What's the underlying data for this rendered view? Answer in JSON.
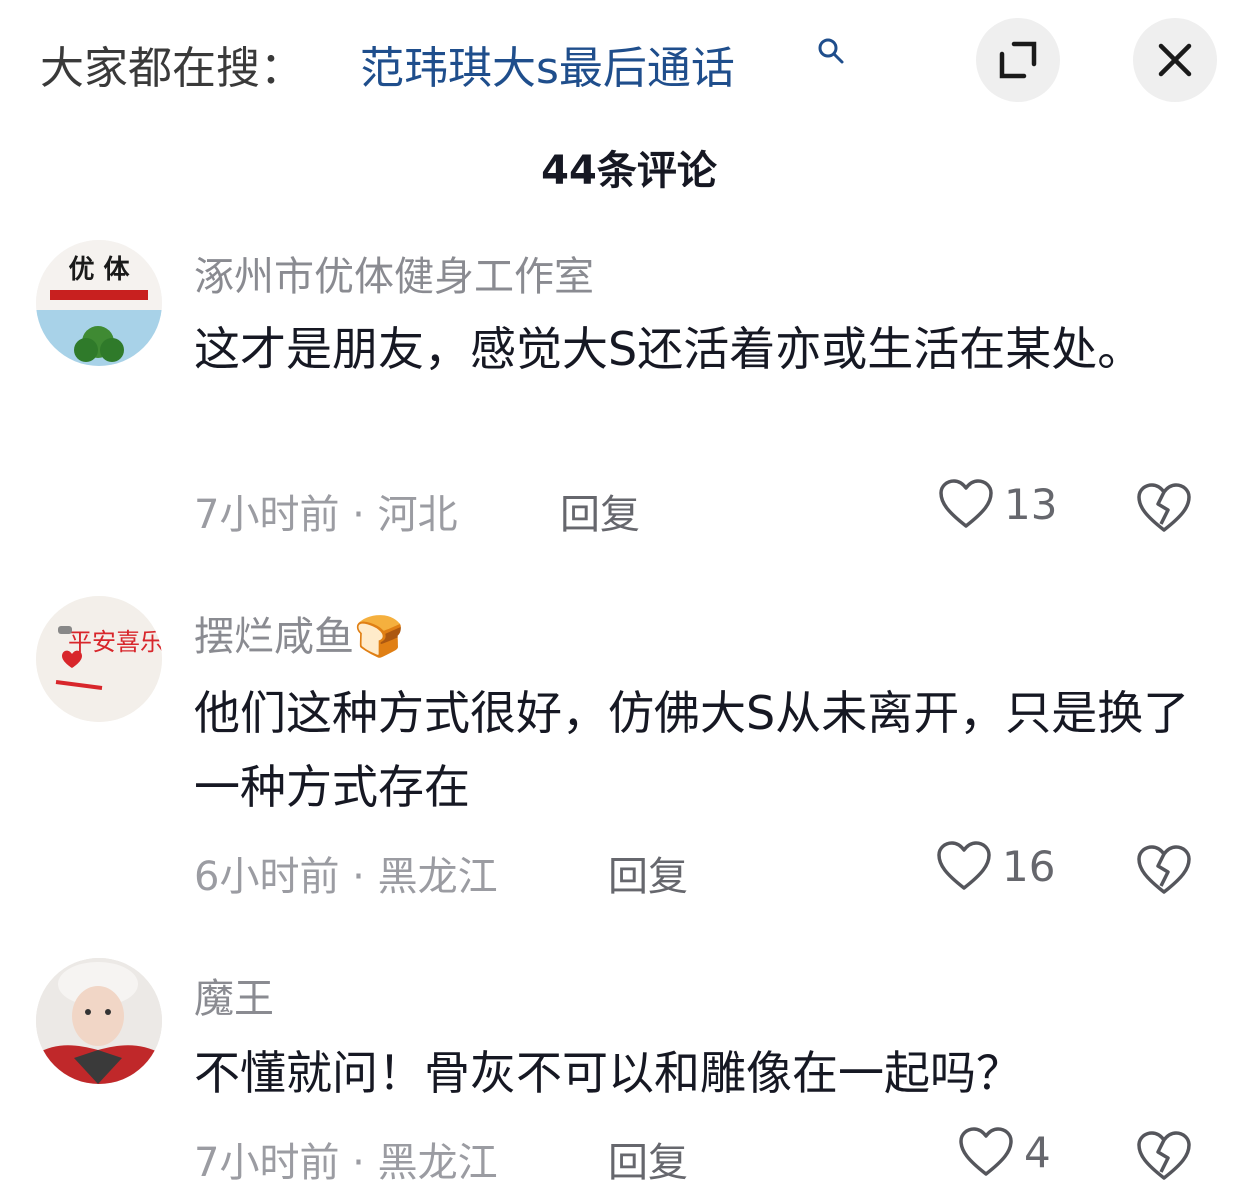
{
  "header": {
    "search_prefix": "大家都在搜：",
    "search_term": "范玮琪大s最后通话",
    "comment_count": "44条评论"
  },
  "comments": [
    {
      "username": "涿州市优体健身工作室",
      "avatar_text": "优 体",
      "text": "这才是朋友，感觉大S还活着亦或生活在某处。",
      "time": "7小时前",
      "location": "河北",
      "reply": "回复",
      "likes": "13"
    },
    {
      "username": "摆烂咸鱼🍞",
      "avatar_text": "平安喜乐",
      "text": "他们这种方式很好，仿佛大S从未离开，只是换了一种方式存在",
      "time": "6小时前",
      "location": "黑龙江",
      "reply": "回复",
      "likes": "16"
    },
    {
      "username": "魔王",
      "text": "不懂就问！骨灰不可以和雕像在一起吗？",
      "time": "7小时前",
      "location": "黑龙江",
      "reply": "回复",
      "likes": "4"
    }
  ],
  "meta_separator": " · "
}
